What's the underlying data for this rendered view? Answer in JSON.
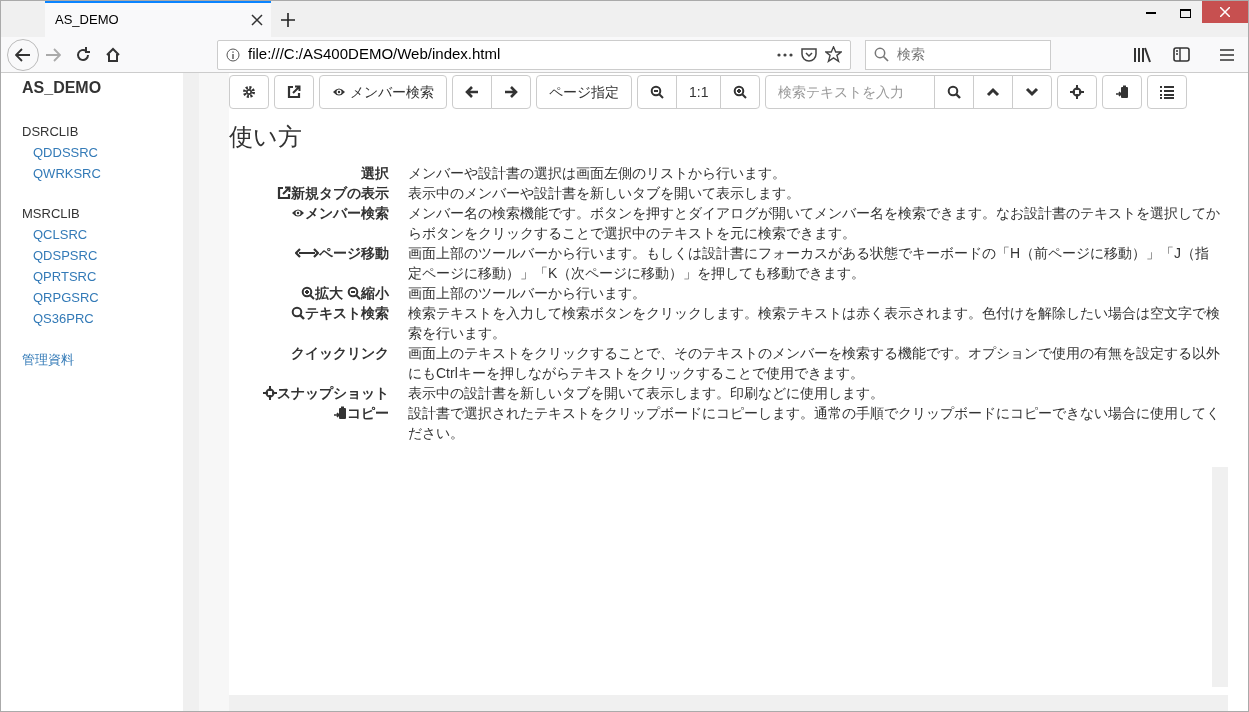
{
  "browser": {
    "tab_title": "AS_DEMO",
    "url": "file:///C:/AS400DEMO/Web/index.html",
    "search_placeholder": "検索"
  },
  "sidebar": {
    "title": "AS_DEMO",
    "groups": [
      {
        "label": "DSRCLIB",
        "items": [
          "QDDSSRC",
          "QWRKSRC"
        ]
      },
      {
        "label": "MSRCLIB",
        "items": [
          "QCLSRC",
          "QDSPSRC",
          "QPRTSRC",
          "QRPGSRC",
          "QS36PRC"
        ]
      }
    ],
    "link": "管理資料"
  },
  "toolbar": [
    {
      "kind": "icon"
    },
    {
      "kind": "icon"
    },
    {
      "kind": "icon_text",
      "label": "メンバー検索"
    },
    {
      "kind": "group",
      "items": [
        {
          "kind": "icon"
        },
        {
          "kind": "icon"
        }
      ]
    },
    {
      "kind": "text",
      "label": "ページ指定"
    },
    {
      "kind": "group",
      "items": [
        {
          "kind": "icon"
        },
        {
          "kind": "text",
          "label": "1:1"
        },
        {
          "kind": "icon"
        }
      ]
    },
    {
      "kind": "group",
      "items": [
        {
          "kind": "field",
          "placeholder": "検索テキストを入力"
        },
        {
          "kind": "icon"
        },
        {
          "kind": "icon"
        },
        {
          "kind": "icon"
        }
      ]
    },
    {
      "kind": "icon"
    },
    {
      "kind": "icon"
    },
    {
      "kind": "icon"
    }
  ],
  "help": {
    "heading": "使い方",
    "rows": [
      {
        "term": [
          "選択"
        ],
        "description": "メンバーや設計書の選択は画面左側のリストから行います。"
      },
      {
        "term": [
          "新規タブの表示"
        ],
        "description": "表示中のメンバーや設計書を新しいタブを開いて表示します。"
      },
      {
        "term": [
          "メンバー検索"
        ],
        "description": "メンバー名の検索機能です。ボタンを押すとダイアログが開いてメンバー名を検索できます。なお設計書のテキストを選択してからボタンをクリックすることで選択中のテキストを元に検索できます。"
      },
      {
        "term": [
          "ページ移動"
        ],
        "description": "画面上部のツールバーから行います。もしくは設計書にフォーカスがある状態でキーボードの「H（前ページに移動）」「J（指定ページに移動）」「K（次ページに移動）」を押しても移動できます。"
      },
      {
        "term": [
          "拡大",
          "縮小"
        ],
        "description": "画面上部のツールバーから行います。"
      },
      {
        "term": [
          "テキスト検索"
        ],
        "description": "検索テキストを入力して検索ボタンをクリックします。検索テキストは赤く表示されます。色付けを解除したい場合は空文字で検索を行います。"
      },
      {
        "term": [
          "クイックリンク"
        ],
        "description": "画面上のテキストをクリックすることで、そのテキストのメンバーを検索する機能です。オプションで使用の有無を設定する以外にもCtrlキーを押しながらテキストをクリックすることで使用できます。"
      },
      {
        "term": [
          "スナップショット"
        ],
        "description": "表示中の設計書を新しいタブを開いて表示します。印刷などに使用します。"
      },
      {
        "term": [
          "コピー"
        ],
        "description": "設計書で選択されたテキストをクリップボードにコピーします。通常の手順でクリップボードにコピーできない場合に使用してください。"
      }
    ]
  }
}
